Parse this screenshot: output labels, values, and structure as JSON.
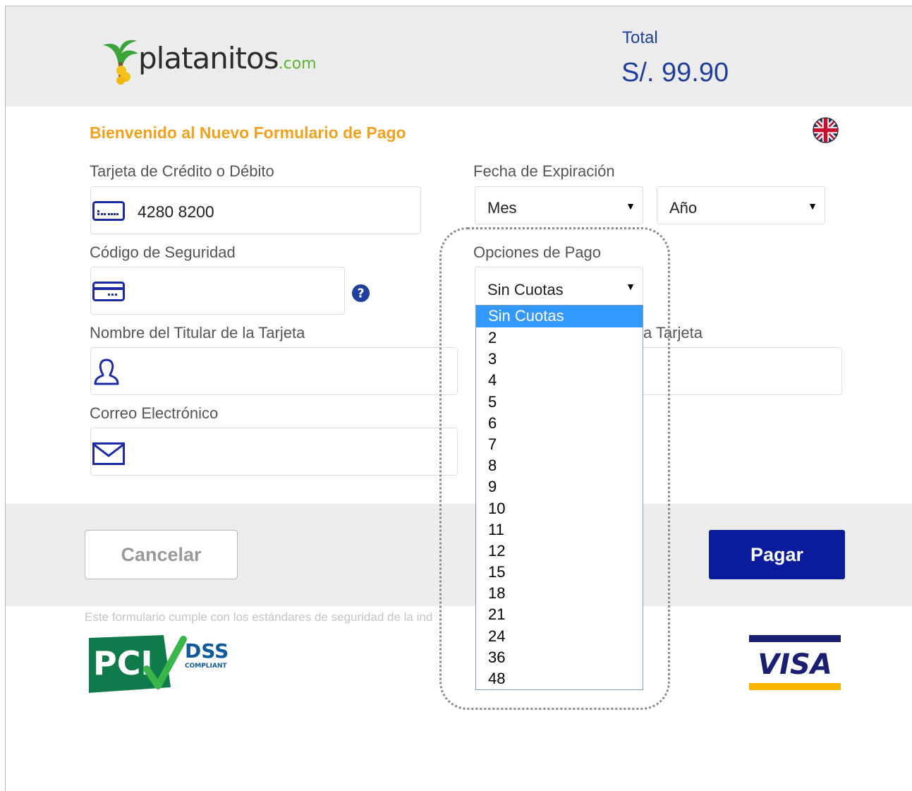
{
  "header": {
    "logo_text": "platanitos",
    "logo_suffix": ".com",
    "total_label": "Total",
    "total_value": "S/. 99.90"
  },
  "form": {
    "welcome": "Bienvenido al Nuevo Formulario de Pago",
    "card_label": "Tarjeta de Crédito o Débito",
    "card_value": "4280 8200",
    "expiry_label": "Fecha de Expiración",
    "month_value": "Mes",
    "year_value": "Año",
    "security_label": "Código de Seguridad",
    "payment_options_label": "Opciones de Pago",
    "payment_option_value": "Sin Cuotas",
    "holder_label": "Nombre del Titular de la Tarjeta",
    "holder_right_label_partial": "a Tarjeta",
    "email_label": "Correo Electrónico"
  },
  "dropdown": {
    "options": [
      "Sin Cuotas",
      "2",
      "3",
      "4",
      "5",
      "6",
      "7",
      "8",
      "9",
      "10",
      "11",
      "12",
      "15",
      "18",
      "21",
      "24",
      "36",
      "48"
    ],
    "selected_index": 0
  },
  "buttons": {
    "cancel": "Cancelar",
    "pay": "Pagar"
  },
  "footer": {
    "compliance_text": "Este formulario cumple con los estándares de seguridad de la ind",
    "pci_main": "PCI",
    "pci_dss": "DSS",
    "pci_compliant": "COMPLIANT",
    "visa": "VISA"
  },
  "colors": {
    "brand_blue": "#081c9c",
    "total_blue": "#1f3f9d",
    "welcome_orange": "#f3a11c",
    "icon_blue": "#1c2aa6",
    "dropdown_highlight": "#3399ff"
  },
  "icons": [
    "card-icon",
    "security-card-icon",
    "help-icon",
    "user-icon",
    "mail-icon",
    "uk-flag-icon",
    "dropdown-arrow-icon"
  ]
}
